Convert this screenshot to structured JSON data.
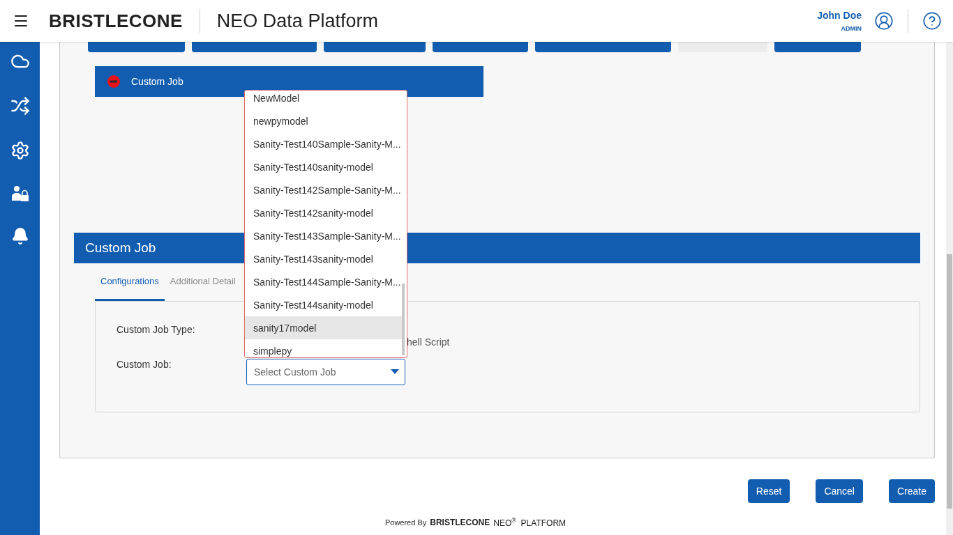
{
  "header": {
    "brand": "BRISTLECONE",
    "title": "NEO Data Platform",
    "user": {
      "name": "John Doe",
      "role": "ADMIN"
    }
  },
  "job_buttons": [
    {
      "disabled": false
    },
    {
      "disabled": false
    },
    {
      "disabled": false
    },
    {
      "disabled": false
    },
    {
      "disabled": false
    },
    {
      "disabled": true
    },
    {
      "disabled": false
    }
  ],
  "active_job": {
    "label": "Custom Job"
  },
  "section": {
    "title": "Custom Job"
  },
  "tabs": [
    {
      "label": "Configurations",
      "selected": true
    },
    {
      "label": "Additional Detail",
      "selected": false
    }
  ],
  "form": {
    "job_type_label": "Custom Job Type:",
    "job_type_option": "hell Script",
    "job_label": "Custom Job:",
    "job_select": {
      "placeholder": "Select Custom Job"
    }
  },
  "dropdown": {
    "items": [
      {
        "label": "NewModel",
        "selected": false
      },
      {
        "label": "newpymodel",
        "selected": false
      },
      {
        "label": "Sanity-Test140Sample-Sanity-M...",
        "selected": false
      },
      {
        "label": "Sanity-Test140sanity-model",
        "selected": false
      },
      {
        "label": "Sanity-Test142Sample-Sanity-M...",
        "selected": false
      },
      {
        "label": "Sanity-Test142sanity-model",
        "selected": false
      },
      {
        "label": "Sanity-Test143Sample-Sanity-M...",
        "selected": false
      },
      {
        "label": "Sanity-Test143sanity-model",
        "selected": false
      },
      {
        "label": "Sanity-Test144Sample-Sanity-M...",
        "selected": false
      },
      {
        "label": "Sanity-Test144sanity-model",
        "selected": false
      },
      {
        "label": "sanity17model",
        "selected": true
      },
      {
        "label": "simplepy",
        "selected": false
      }
    ]
  },
  "actions": [
    "Reset",
    "Cancel",
    "Create"
  ],
  "footer": {
    "powered_by": "Powered By",
    "brand": "BRISTLECONE",
    "product": "NEO$^{®}$  PLATFORM"
  }
}
